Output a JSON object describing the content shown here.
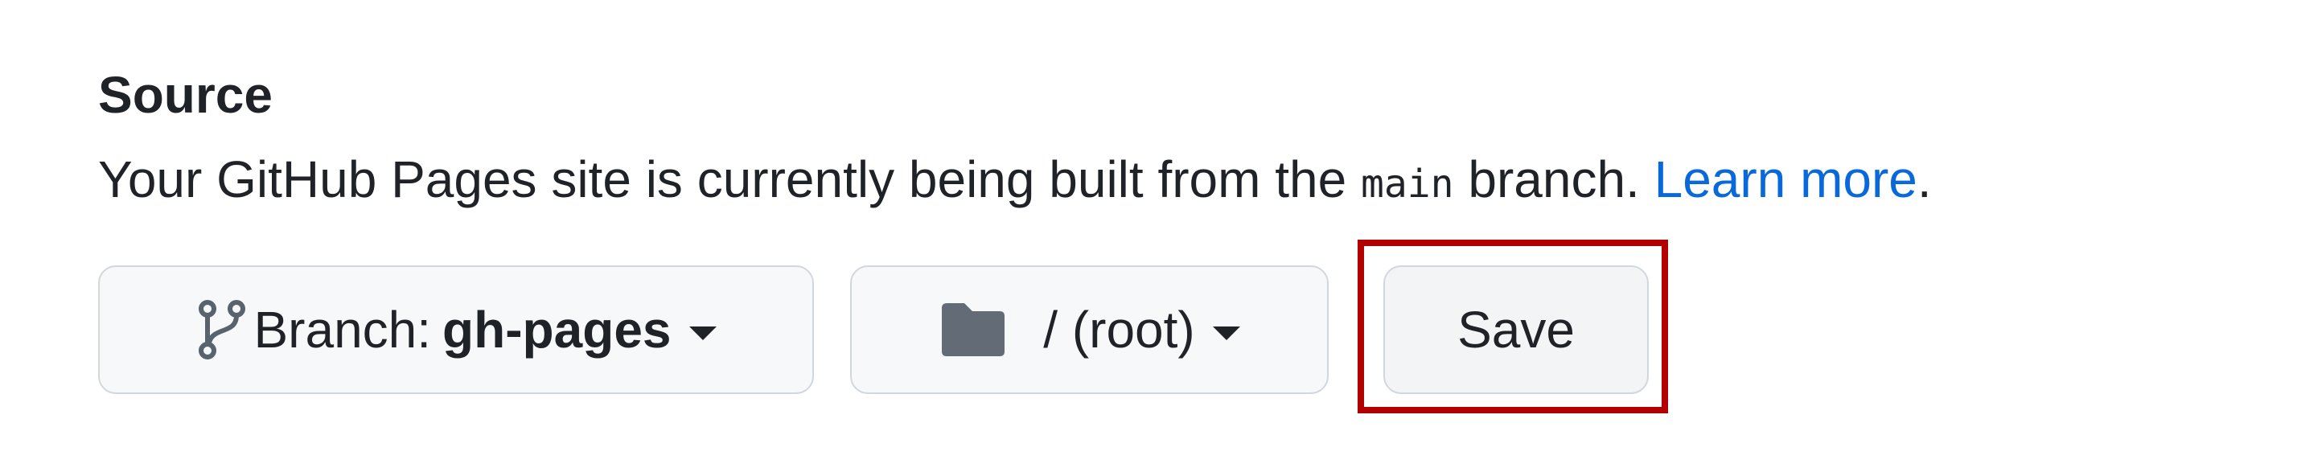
{
  "source": {
    "heading": "Source",
    "description": {
      "prefix": "Your GitHub Pages site is currently being built from the ",
      "branch_code": "main",
      "suffix": " branch. ",
      "link_text": "Learn more",
      "period": "."
    }
  },
  "controls": {
    "branch_button": {
      "label": "Branch:",
      "value": "gh-pages",
      "icon": "git-branch-icon"
    },
    "folder_button": {
      "label": "/ (root)",
      "icon": "folder-icon"
    },
    "save_button": {
      "label": "Save"
    }
  },
  "colors": {
    "link": "#0969da",
    "highlight_box": "#b30000",
    "button_background": "#f6f8fa",
    "button_border": "#d0d7de"
  }
}
